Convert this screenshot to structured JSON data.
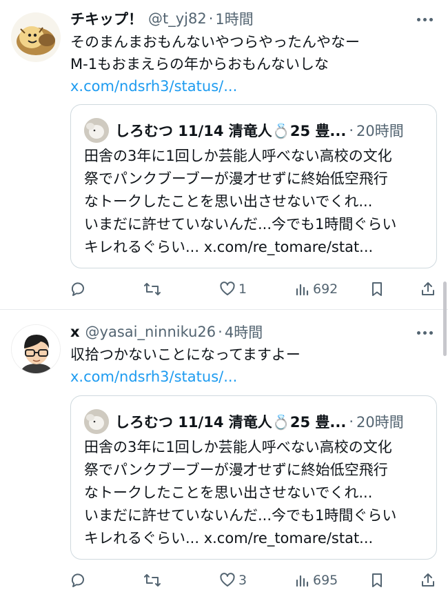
{
  "tweets": [
    {
      "display_name": "チキップ！",
      "handle": "@t_yj82",
      "dot": "·",
      "time": "1時間",
      "text_lines": [
        "そのまんまおもんないやつらやったんやなー",
        "M-1もおまえらの年からおもんないしな"
      ],
      "link": "x.com/ndsrh3/status/...",
      "quote": {
        "name": "しろむつ 11/14 清竜人💍25 豊...",
        "dot": "·",
        "time": "20時間",
        "lines": [
          "田舎の3年に1回しか芸能人呼べない高校の文化",
          "祭でパンクブーブーが漫才せずに終始低空飛行",
          "なトークしたことを思い出させないでくれ...",
          "いまだに許せていないんだ...今でも1時間ぐらい"
        ],
        "last_text": "キレれるぐらい... ",
        "last_link": "x.com/re_tomare/stat..."
      },
      "actions": {
        "reply": "",
        "retweet": "",
        "like": "1",
        "views": "692"
      }
    },
    {
      "display_name": "x",
      "handle": "@yasai_ninniku26",
      "dot": "·",
      "time": "4時間",
      "text_lines": [
        "収拾つかないことになってますよー"
      ],
      "link": "x.com/ndsrh3/status/...",
      "quote": {
        "name": "しろむつ 11/14 清竜人💍25 豊...",
        "dot": "·",
        "time": "20時間",
        "lines": [
          "田舎の3年に1回しか芸能人呼べない高校の文化",
          "祭でパンクブーブーが漫才せずに終始低空飛行",
          "なトークしたことを思い出させないでくれ...",
          "いまだに許せていないんだ...今でも1時間ぐらい"
        ],
        "last_text": "キレれるぐらい... ",
        "last_link": "x.com/re_tomare/stat..."
      },
      "actions": {
        "reply": "",
        "retweet": "",
        "like": "3",
        "views": "695"
      }
    }
  ],
  "colors": {
    "link": "#1d9bf0",
    "secondary_text": "#536471",
    "border": "#cfd9de"
  },
  "icons": [
    "reply-icon",
    "retweet-icon",
    "like-icon",
    "views-icon",
    "bookmark-icon",
    "share-icon",
    "more-icon"
  ]
}
